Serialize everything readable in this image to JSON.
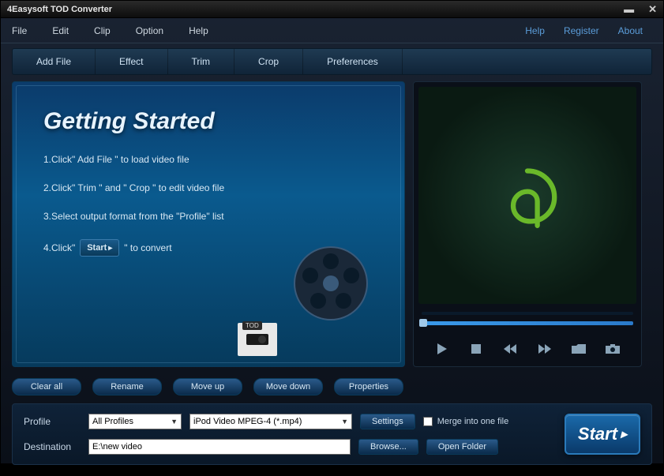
{
  "title": "4Easysoft TOD Converter",
  "menubar": {
    "items": [
      "File",
      "Edit",
      "Clip",
      "Option",
      "Help"
    ],
    "links": [
      "Help",
      "Register",
      "About"
    ]
  },
  "toolbar": {
    "items": [
      "Add File",
      "Effect",
      "Trim",
      "Crop",
      "Preferences"
    ]
  },
  "getting_started": {
    "heading": "Getting Started",
    "step1": "1.Click\" Add File \" to load video file",
    "step2": "2.Click\" Trim \" and \" Crop \" to edit video file",
    "step3": "3.Select output format from the \"Profile\" list",
    "step4_pre": "4.Click\"",
    "step4_btn": "Start",
    "step4_post": "\" to convert",
    "tod_label": "TOD"
  },
  "list_buttons": [
    "Clear all",
    "Rename",
    "Move up",
    "Move down",
    "Properties"
  ],
  "profile": {
    "label": "Profile",
    "category": "All Profiles",
    "format": "iPod Video MPEG-4 (*.mp4)",
    "settings_btn": "Settings",
    "merge_label": "Merge into one file"
  },
  "destination": {
    "label": "Destination",
    "path": "E:\\new video",
    "browse_btn": "Browse...",
    "open_btn": "Open Folder"
  },
  "start_btn": "Start"
}
